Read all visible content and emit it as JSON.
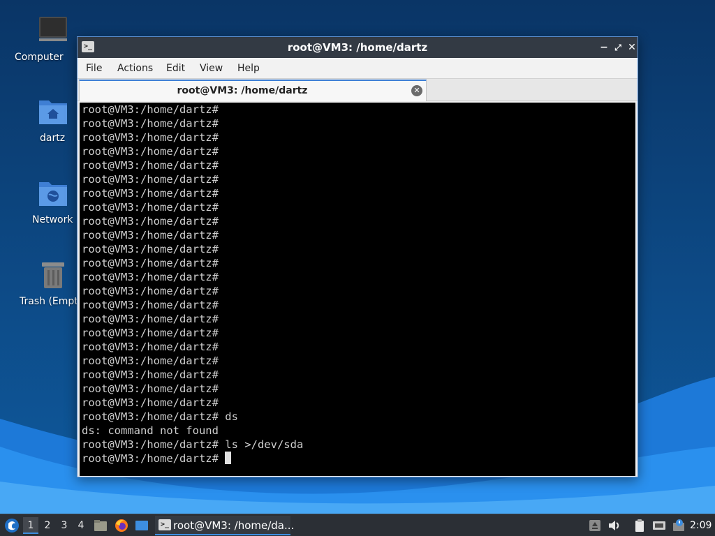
{
  "desktop": {
    "icons": [
      {
        "label": "Computer",
        "icon": "computer-icon"
      },
      {
        "label": "dartz",
        "icon": "home-folder-icon"
      },
      {
        "label": "Network",
        "icon": "network-folder-icon"
      },
      {
        "label": "Trash (Empty)",
        "icon": "trash-icon"
      }
    ]
  },
  "window": {
    "title": "root@VM3: /home/dartz",
    "menu": [
      "File",
      "Actions",
      "Edit",
      "View",
      "Help"
    ],
    "tab_label": "root@VM3: /home/dartz",
    "terminal_lines": [
      "root@VM3:/home/dartz#",
      "root@VM3:/home/dartz#",
      "root@VM3:/home/dartz#",
      "root@VM3:/home/dartz#",
      "root@VM3:/home/dartz#",
      "root@VM3:/home/dartz#",
      "root@VM3:/home/dartz#",
      "root@VM3:/home/dartz#",
      "root@VM3:/home/dartz#",
      "root@VM3:/home/dartz#",
      "root@VM3:/home/dartz#",
      "root@VM3:/home/dartz#",
      "root@VM3:/home/dartz#",
      "root@VM3:/home/dartz#",
      "root@VM3:/home/dartz#",
      "root@VM3:/home/dartz#",
      "root@VM3:/home/dartz#",
      "root@VM3:/home/dartz#",
      "root@VM3:/home/dartz#",
      "root@VM3:/home/dartz#",
      "root@VM3:/home/dartz#",
      "root@VM3:/home/dartz#",
      "root@VM3:/home/dartz# ds",
      "ds: command not found",
      "root@VM3:/home/dartz# ls >/dev/sda"
    ],
    "prompt": "root@VM3:/home/dartz# "
  },
  "taskbar": {
    "workspaces": [
      "1",
      "2",
      "3",
      "4"
    ],
    "active_workspace": "1",
    "task_label": "root@VM3: /home/da...",
    "clock": "2:09"
  },
  "colors": {
    "accent": "#3d8ee0",
    "titlebar": "#333a44",
    "terminal_bg": "#000000",
    "terminal_fg": "#cfcfcf"
  }
}
